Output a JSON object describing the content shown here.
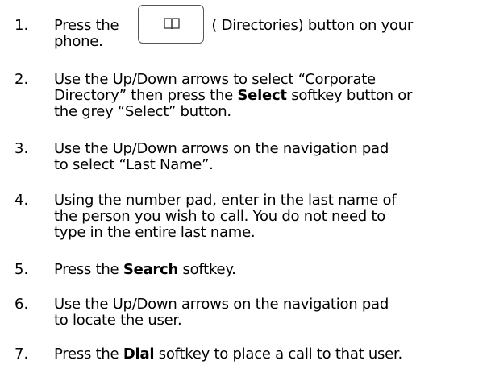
{
  "steps": [
    {
      "num": "1.",
      "line1_pre": "Press the",
      "line1_post": "( Directories) button on your",
      "line2": "phone.",
      "button_icon": "book-icon"
    },
    {
      "num": "2.",
      "line1": "Use the Up/Down arrows  to select “Corporate",
      "line2_pre": "Directory” then press the ",
      "line2_bold": "Select",
      "line2_post": " softkey button or",
      "line3": "the grey “Select” button."
    },
    {
      "num": "3.",
      "line1": "Use the Up/Down arrows on the navigation pad",
      "line2": "to select “Last Name”."
    },
    {
      "num": "4.",
      "line1": "Using the number pad, enter in the last name of",
      "line2": "the person you wish to call. You do not need to",
      "line3": "type in the entire last name."
    },
    {
      "num": "5.",
      "pre": "Press the ",
      "bold": "Search",
      "post": " softkey."
    },
    {
      "num": "6.",
      "line1": "Use the Up/Down arrows on the navigation pad",
      "line2": "to  locate the user."
    },
    {
      "num": "7.",
      "pre": "Press the ",
      "bold": "Dial",
      "post": " softkey to place a call to that user."
    }
  ]
}
